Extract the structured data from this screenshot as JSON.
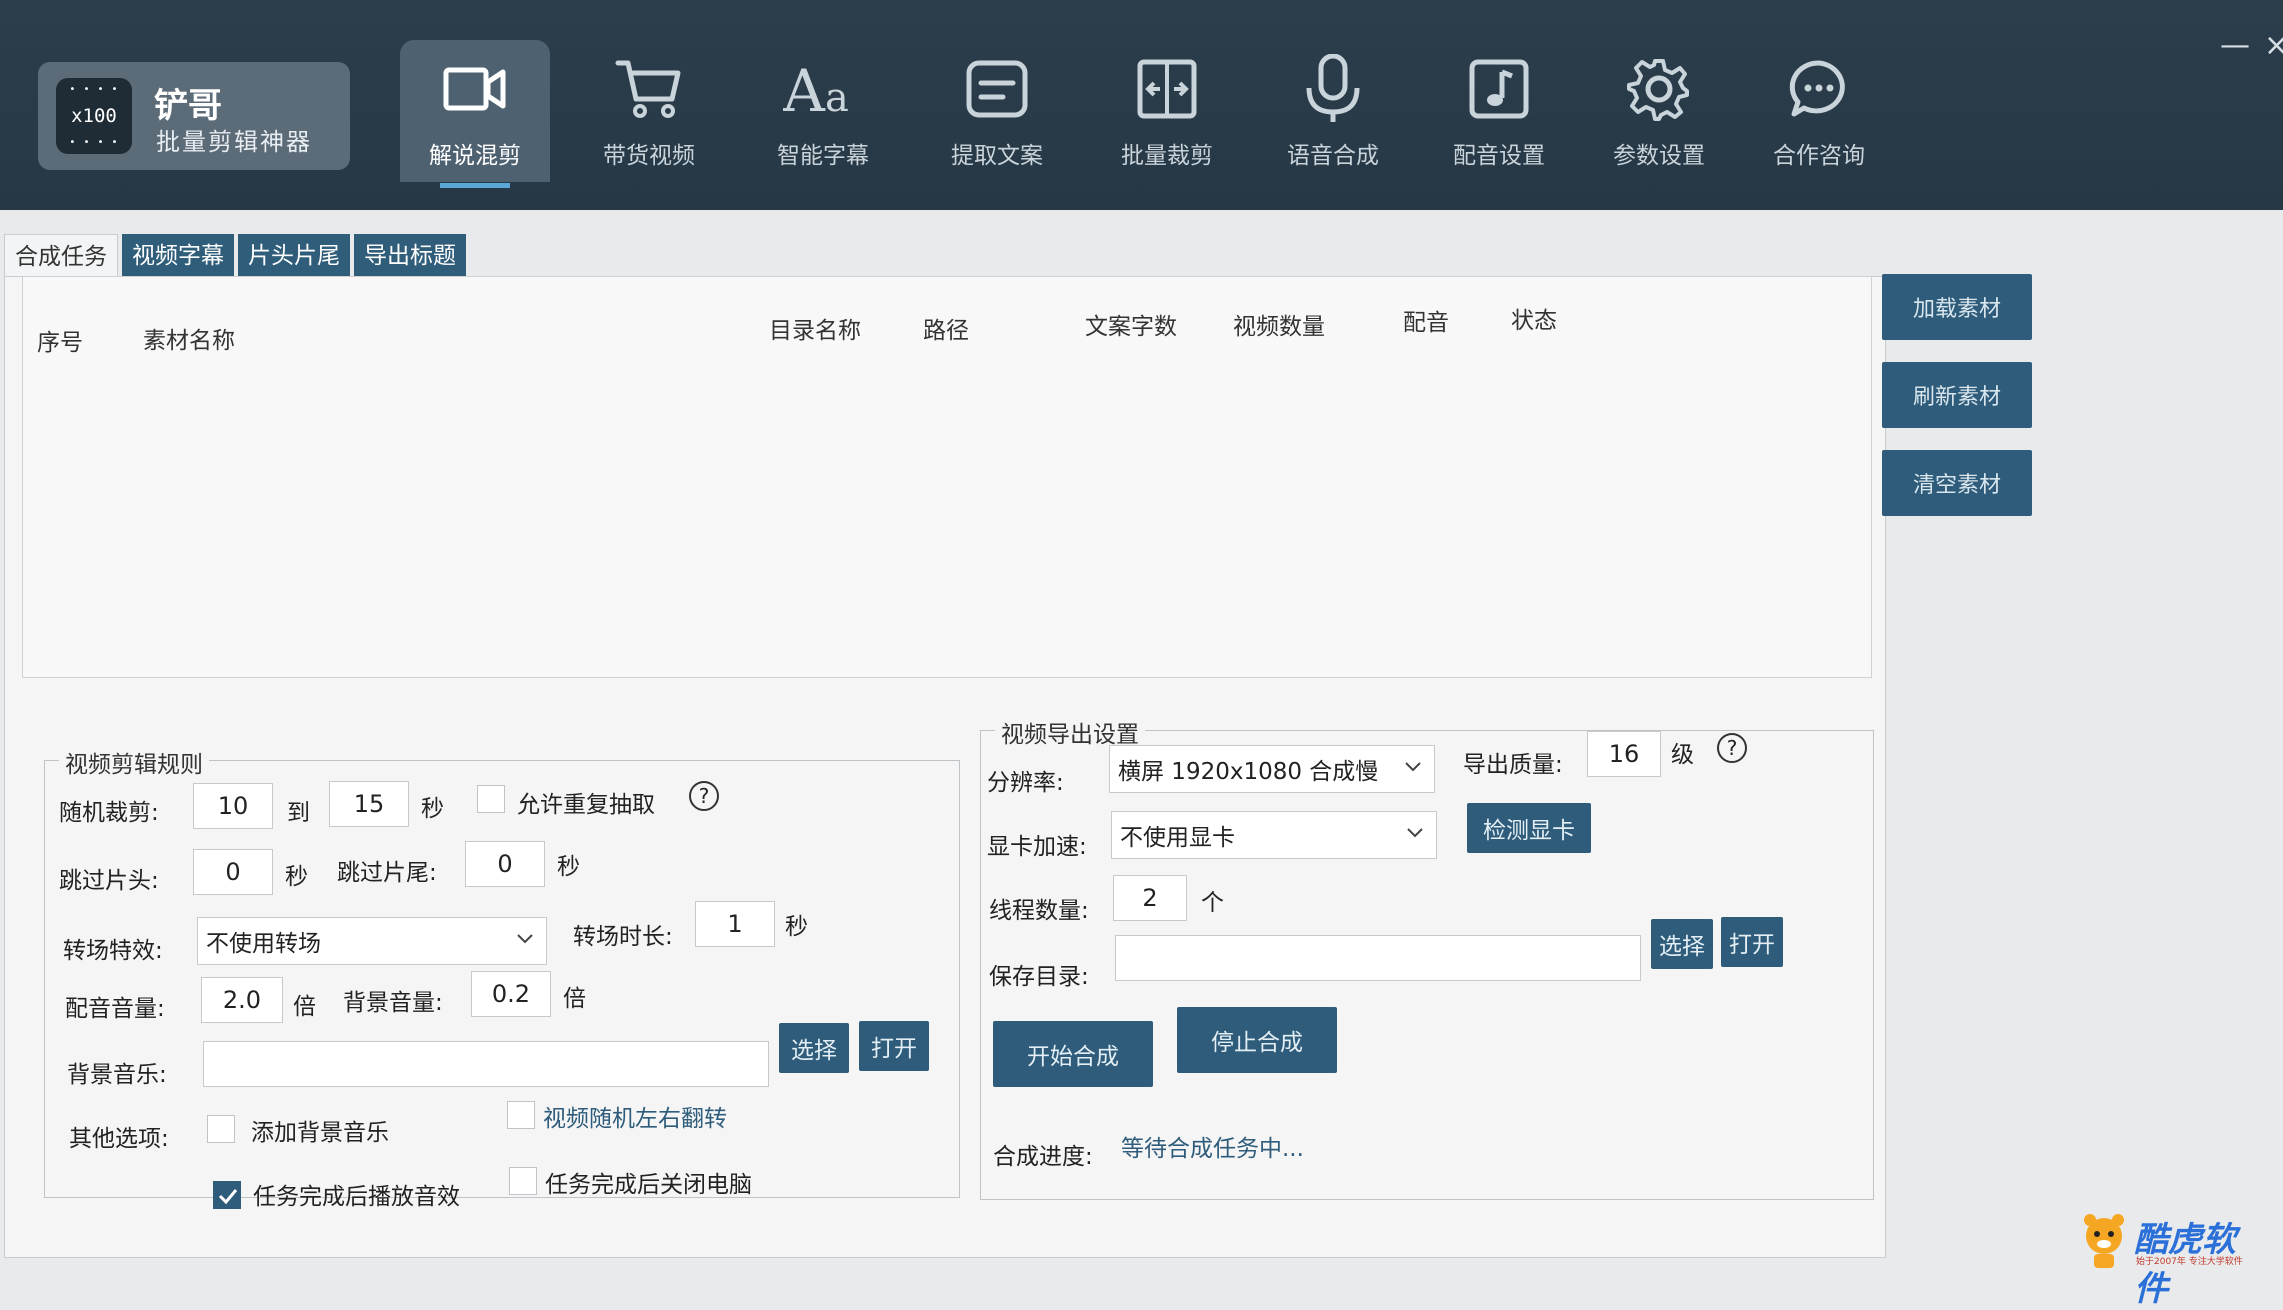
{
  "logo": {
    "badge": "x100",
    "name": "铲哥",
    "subtitle": "批量剪辑神器"
  },
  "nav": [
    {
      "label": "解说混剪",
      "icon": "video-camera-icon",
      "active": true
    },
    {
      "label": "带货视频",
      "icon": "shopping-cart-icon"
    },
    {
      "label": "智能字幕",
      "icon": "font-aa-icon"
    },
    {
      "label": "提取文案",
      "icon": "text-extract-icon"
    },
    {
      "label": "批量裁剪",
      "icon": "crop-icon"
    },
    {
      "label": "语音合成",
      "icon": "microphone-icon"
    },
    {
      "label": "配音设置",
      "icon": "music-note-icon"
    },
    {
      "label": "参数设置",
      "icon": "gear-icon"
    },
    {
      "label": "合作咨询",
      "icon": "chat-bubble-icon"
    }
  ],
  "window": {
    "minimize": "—",
    "close": "×"
  },
  "tabs": [
    "合成任务",
    "视频字幕",
    "片头片尾",
    "导出标题"
  ],
  "table": {
    "columns": [
      "序号",
      "素材名称",
      "目录名称",
      "路径",
      "文案字数",
      "视频数量",
      "配音",
      "状态"
    ]
  },
  "side_buttons": [
    "加载素材",
    "刷新素材",
    "清空素材"
  ],
  "edit_rules": {
    "title": "视频剪辑规则",
    "random_cut_label": "随机裁剪:",
    "random_from": "10",
    "to_label": "到",
    "random_to": "15",
    "sec": "秒",
    "allow_repeat_label": "允许重复抽取",
    "skip_head_label": "跳过片头:",
    "skip_head": "0",
    "skip_tail_label": "跳过片尾:",
    "skip_tail": "0",
    "transition_label": "转场特效:",
    "transition_value": "不使用转场",
    "transition_dur_label": "转场时长:",
    "transition_dur": "1",
    "voice_vol_label": "配音音量:",
    "voice_vol": "2.0",
    "times": "倍",
    "bg_vol_label": "背景音量:",
    "bg_vol": "0.2",
    "bg_music_label": "背景音乐:",
    "bg_music_value": "",
    "select_btn": "选择",
    "open_btn": "打开",
    "other_label": "其他选项:",
    "opt_add_bgm": "添加背景音乐",
    "opt_random_flip": "视频随机左右翻转",
    "opt_play_sound": "任务完成后播放音效",
    "opt_shutdown": "任务完成后关闭电脑",
    "help": "?"
  },
  "export": {
    "title": "视频导出设置",
    "resolution_label": "分辨率:",
    "resolution_value": "横屏 1920x1080 合成慢",
    "quality_label": "导出质量:",
    "quality_value": "16",
    "quality_unit": "级",
    "gpu_label": "显卡加速:",
    "gpu_value": "不使用显卡",
    "detect_gpu_btn": "检测显卡",
    "threads_label": "线程数量:",
    "threads_value": "2",
    "threads_unit": "个",
    "save_dir_label": "保存目录:",
    "save_dir_value": "",
    "select_btn": "选择",
    "open_btn": "打开",
    "start_btn": "开始合成",
    "stop_btn": "停止合成",
    "progress_label": "合成进度:",
    "progress_value": "等待合成任务中...",
    "help": "?"
  },
  "watermark": {
    "brand": "酷虎软件",
    "tagline": "始于2007年 专注大学软件"
  },
  "colors": {
    "toolbar": "#263746",
    "accent": "#2e5c7a",
    "panel": "#f5f5f6"
  }
}
